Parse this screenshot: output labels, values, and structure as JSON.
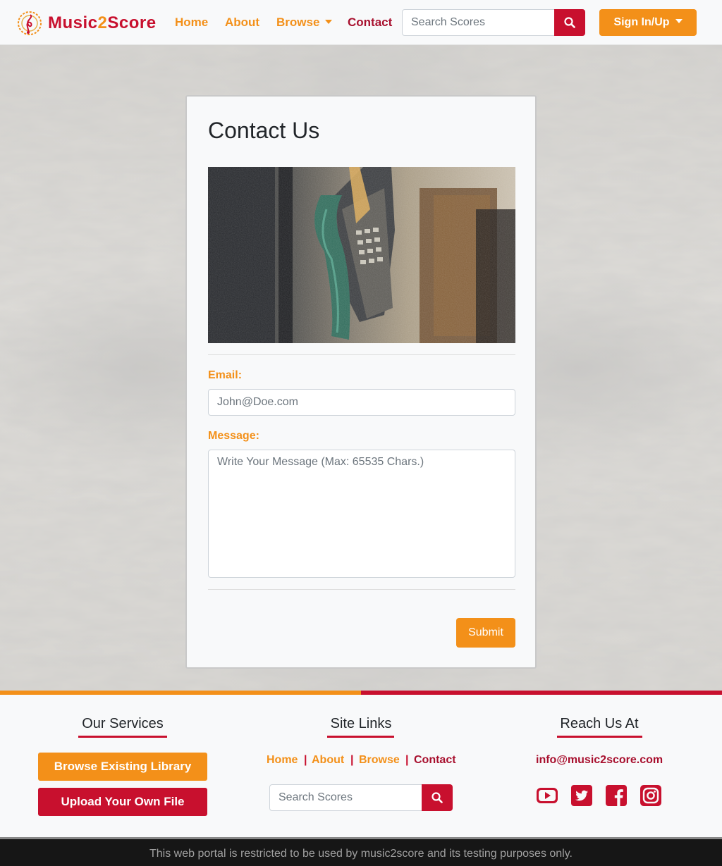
{
  "brand": {
    "name_part1": "Music",
    "name_part2": "2",
    "name_part3": "Score"
  },
  "nav": {
    "home": "Home",
    "about": "About",
    "browse": "Browse",
    "contact": "Contact",
    "search_placeholder": "Search Scores",
    "signin": "Sign In/Up"
  },
  "contact": {
    "title": "Contact Us",
    "email_label": "Email:",
    "email_placeholder": "John@Doe.com",
    "message_label": "Message:",
    "message_placeholder": "Write Your Message (Max: 65535 Chars.)",
    "submit": "Submit"
  },
  "footer": {
    "services_heading": "Our Services",
    "browse_library": "Browse Existing Library",
    "upload_file": "Upload Your Own File",
    "links_heading": "Site Links",
    "links": [
      "Home",
      "About",
      "Browse",
      "Contact"
    ],
    "separator": "|",
    "search_placeholder": "Search Scores",
    "reach_heading": "Reach Us At",
    "email": "info@music2score.com",
    "social": [
      "youtube-icon",
      "twitter-icon",
      "facebook-icon",
      "instagram-icon"
    ],
    "notice": "This web portal is restricted to be used by music2score and its testing purposes only."
  },
  "colors": {
    "orange": "#f39019",
    "crimson": "#c8102e",
    "dark_crimson": "#a8102e"
  }
}
